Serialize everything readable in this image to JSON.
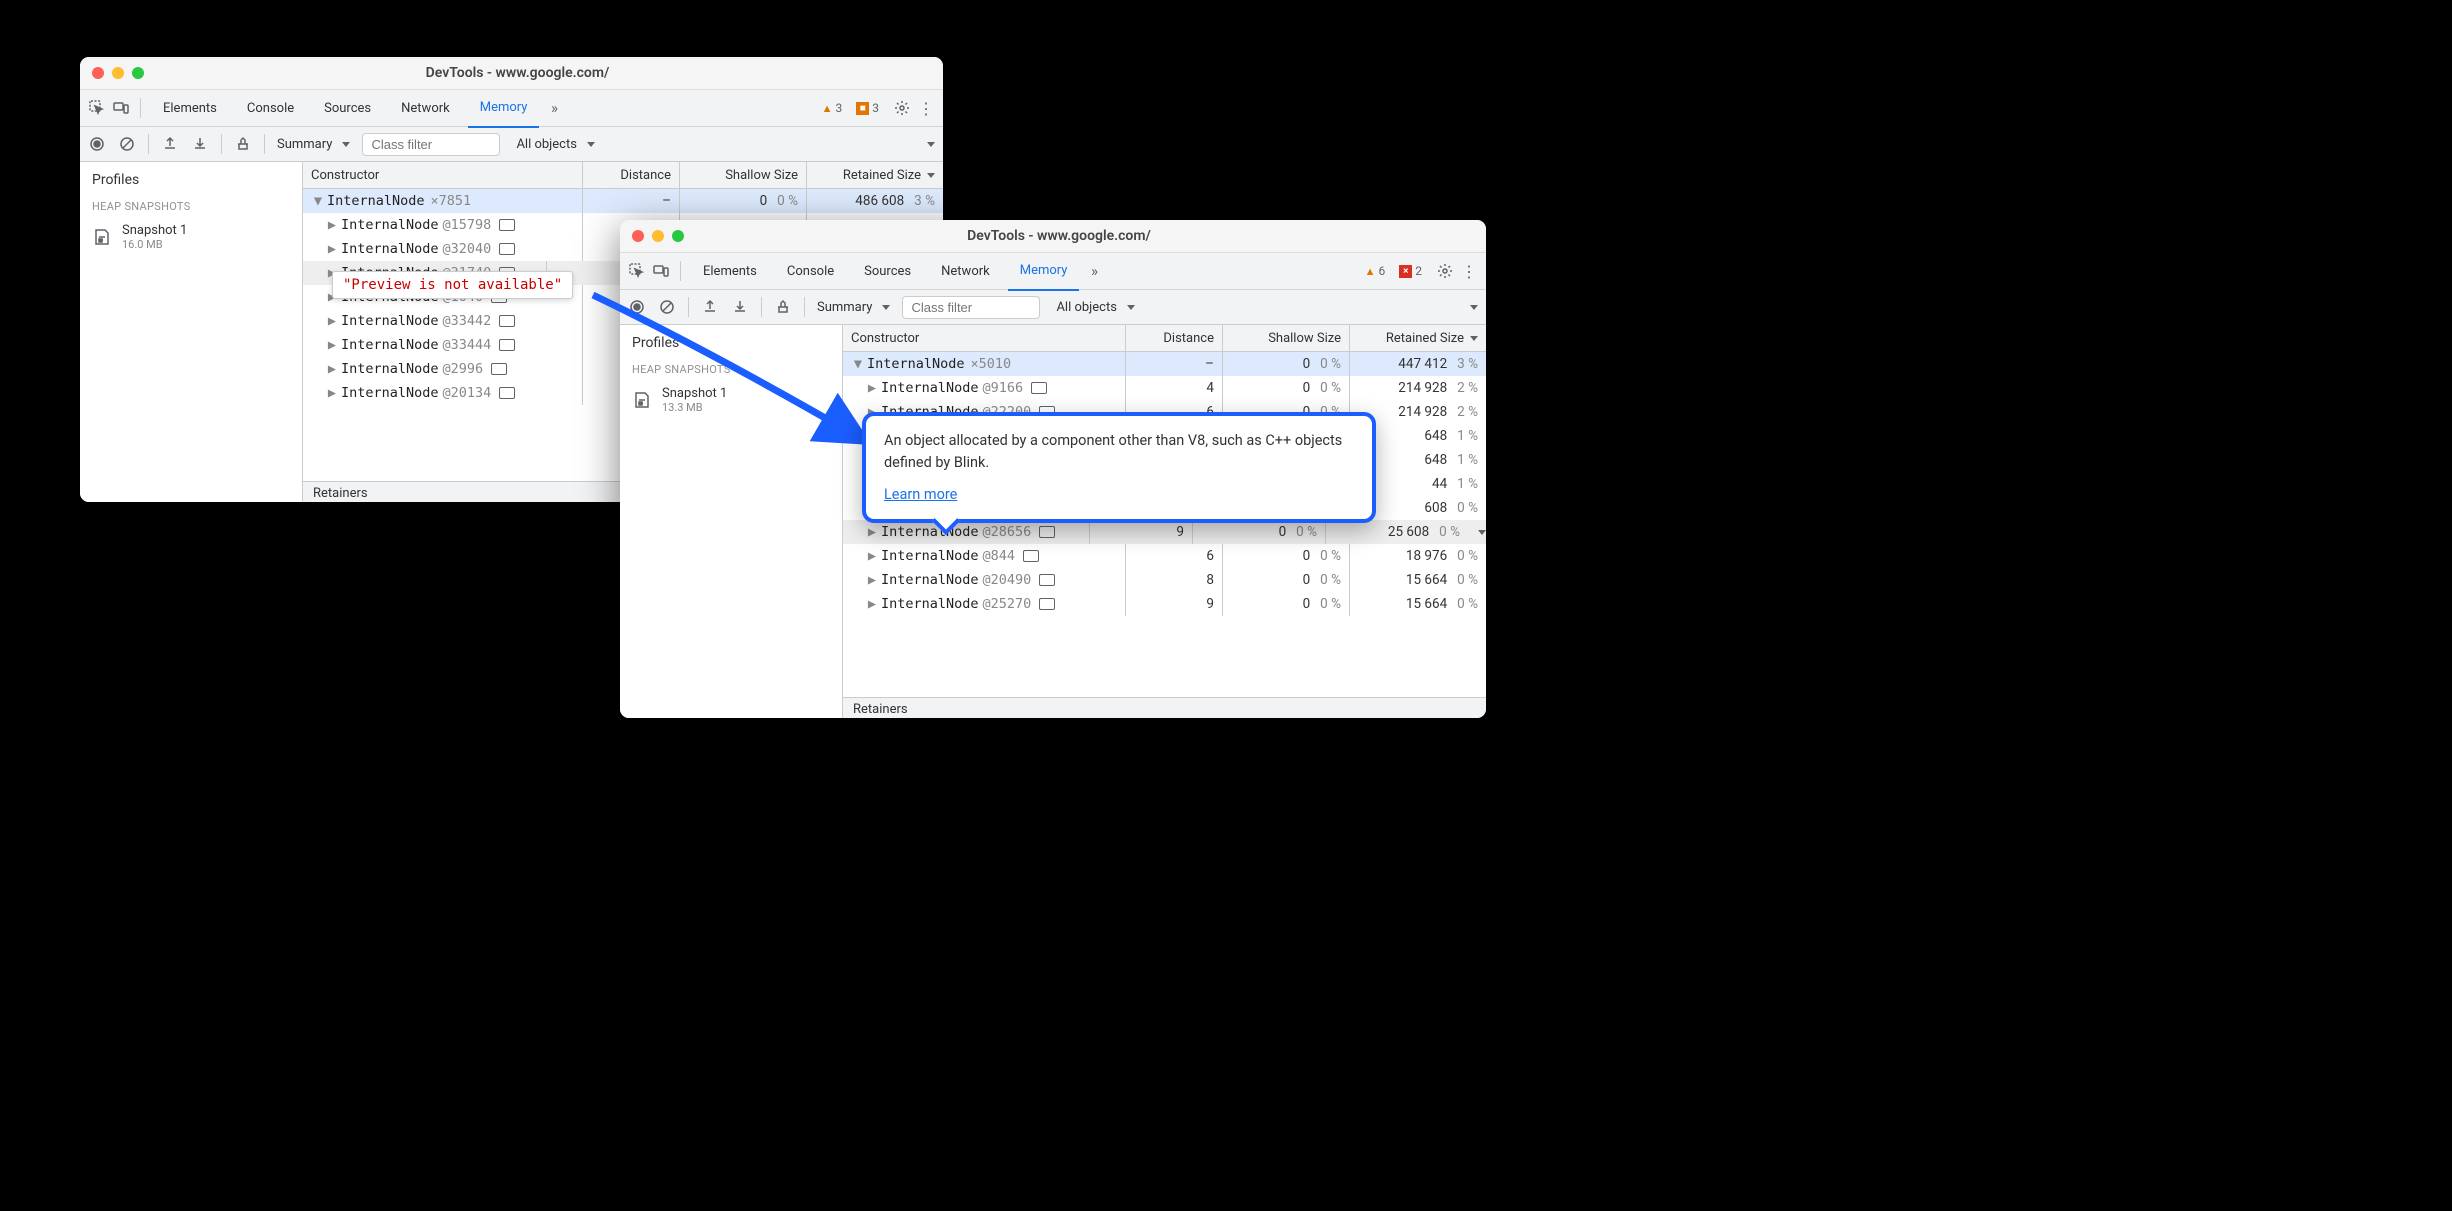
{
  "win1": {
    "title": "DevTools - www.google.com/",
    "tabs": [
      "Elements",
      "Console",
      "Sources",
      "Network",
      "Memory"
    ],
    "activeTab": "Memory",
    "warnCount": "3",
    "errCount": "3",
    "viewLabel": "Summary",
    "filterPlaceholder": "Class filter",
    "scopeLabel": "All objects",
    "side": {
      "profiles": "Profiles",
      "heap": "HEAP SNAPSHOTS",
      "snapName": "Snapshot 1",
      "snapSize": "16.0 MB"
    },
    "cols": {
      "c1": "Constructor",
      "c2": "Distance",
      "c3": "Shallow Size",
      "c4": "Retained Size"
    },
    "topRow": {
      "name": "InternalNode",
      "mult": "×7851",
      "dist": "–",
      "shallow": "0",
      "shallowPct": "0 %",
      "retained": "486 608",
      "retainedPct": "3 %"
    },
    "childRows": [
      {
        "name": "InternalNode",
        "at": "@15798"
      },
      {
        "name": "InternalNode",
        "at": "@32040"
      },
      {
        "name": "InternalNode",
        "at": "@31740"
      },
      {
        "name": "InternalNode",
        "at": "@1040"
      },
      {
        "name": "InternalNode",
        "at": "@33442"
      },
      {
        "name": "InternalNode",
        "at": "@33444"
      },
      {
        "name": "InternalNode",
        "at": "@2996"
      },
      {
        "name": "InternalNode",
        "at": "@20134"
      }
    ],
    "tooltip": "\"Preview is not available\"",
    "retainers": "Retainers"
  },
  "win2": {
    "title": "DevTools - www.google.com/",
    "tabs": [
      "Elements",
      "Console",
      "Sources",
      "Network",
      "Memory"
    ],
    "activeTab": "Memory",
    "warnCount": "6",
    "errCount": "2",
    "viewLabel": "Summary",
    "filterPlaceholder": "Class filter",
    "scopeLabel": "All objects",
    "side": {
      "profiles": "Profiles",
      "heap": "HEAP SNAPSHOTS",
      "snapName": "Snapshot 1",
      "snapSize": "13.3 MB"
    },
    "cols": {
      "c1": "Constructor",
      "c2": "Distance",
      "c3": "Shallow Size",
      "c4": "Retained Size"
    },
    "topRow": {
      "name": "InternalNode",
      "mult": "×5010",
      "dist": "–",
      "shallow": "0",
      "shallowPct": "0 %",
      "retained": "447 412",
      "retainedPct": "3 %"
    },
    "childRows": [
      {
        "name": "InternalNode",
        "at": "@9166",
        "dist": "4",
        "shallow": "0",
        "shallowPct": "0 %",
        "retained": "214 928",
        "retainedPct": "2 %"
      },
      {
        "name": "InternalNode",
        "at": "@22200",
        "dist": "6",
        "shallow": "0",
        "shallowPct": "0 %",
        "retained": "214 928",
        "retainedPct": "2 %"
      },
      {
        "name": "",
        "at": "",
        "dist": "",
        "shallow": "",
        "shallowPct": "",
        "retained": "648",
        "retainedPct": "1 %"
      },
      {
        "name": "",
        "at": "",
        "dist": "",
        "shallow": "",
        "shallowPct": "",
        "retained": "648",
        "retainedPct": "1 %"
      },
      {
        "name": "",
        "at": "",
        "dist": "",
        "shallow": "",
        "shallowPct": "",
        "retained": "44",
        "retainedPct": "1 %"
      },
      {
        "name": "",
        "at": "",
        "dist": "",
        "shallow": "",
        "shallowPct": "",
        "retained": "608",
        "retainedPct": "0 %"
      },
      {
        "name": "InternalNode",
        "at": "@28656",
        "dist": "9",
        "shallow": "0",
        "shallowPct": "0 %",
        "retained": "25 608",
        "retainedPct": "0 %"
      },
      {
        "name": "InternalNode",
        "at": "@844",
        "dist": "6",
        "shallow": "0",
        "shallowPct": "0 %",
        "retained": "18 976",
        "retainedPct": "0 %"
      },
      {
        "name": "InternalNode",
        "at": "@20490",
        "dist": "8",
        "shallow": "0",
        "shallowPct": "0 %",
        "retained": "15 664",
        "retainedPct": "0 %"
      },
      {
        "name": "InternalNode",
        "at": "@25270",
        "dist": "9",
        "shallow": "0",
        "shallowPct": "0 %",
        "retained": "15 664",
        "retainedPct": "0 %"
      }
    ],
    "popover": {
      "text": "An object allocated by a component other than V8, such as C++ objects defined by Blink.",
      "learn": "Learn more"
    },
    "retainers": "Retainers"
  }
}
